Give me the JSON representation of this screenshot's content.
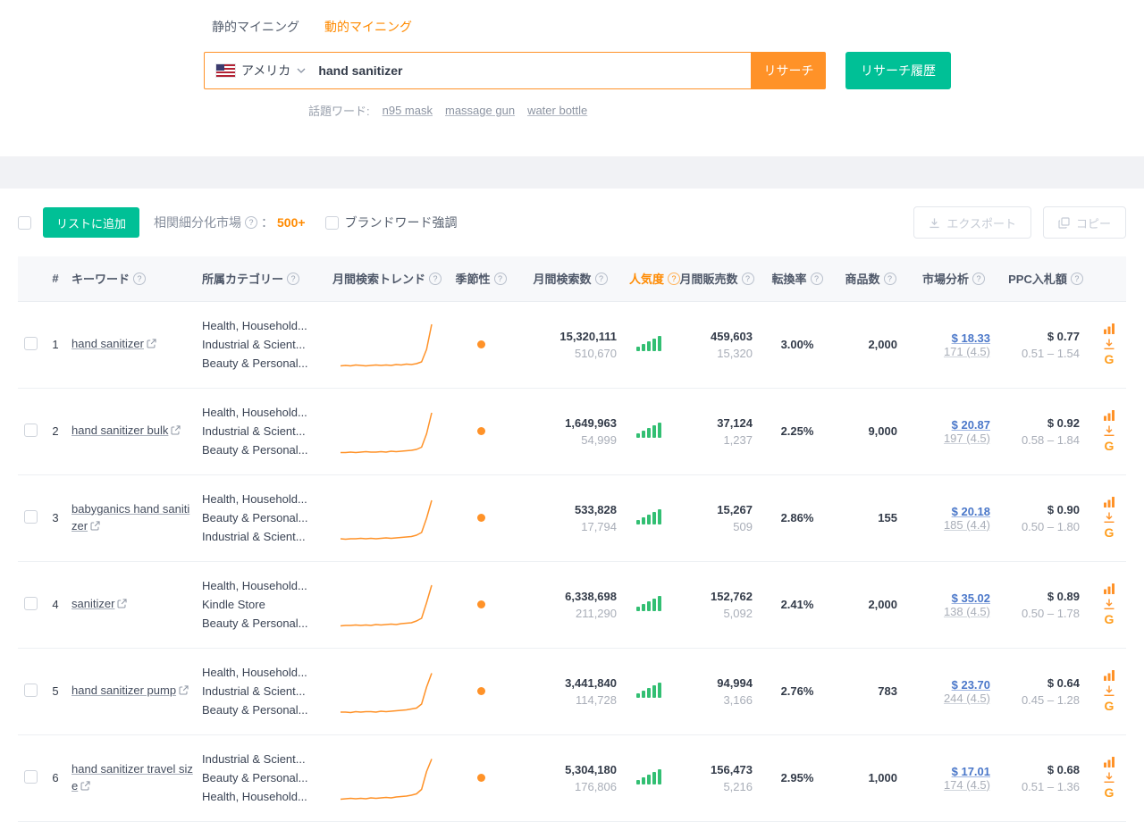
{
  "colors": {
    "accent_orange": "#ff9228",
    "accent_green": "#00c096",
    "popularity_green": "#33bf73",
    "link_blue": "#4a77c9"
  },
  "icons": {
    "help": "?",
    "google": "G"
  },
  "tabs": [
    {
      "label": "静的マイニング",
      "active": false
    },
    {
      "label": "動的マイニング",
      "active": true
    }
  ],
  "search": {
    "country": "アメリカ",
    "query": "hand sanitizer",
    "research_button": "リサーチ",
    "history_button": "リサーチ履歴",
    "hot_label": "話題ワード:",
    "hot_words": [
      "n95 mask",
      "massage gun",
      "water bottle"
    ]
  },
  "toolbar": {
    "add_to_list": "リストに追加",
    "niche_label": "相関細分化市場",
    "niche_colon": "：",
    "niche_value": "500+",
    "brand_toggle": "ブランドワード強調",
    "export": "エクスポート",
    "copy": "コピー"
  },
  "table": {
    "headers": {
      "index": "#",
      "keyword": "キーワード",
      "category": "所属カテゴリー",
      "trend": "月間検索トレンド",
      "season": "季節性",
      "search_volume": "月間検索数",
      "popularity": "人気度",
      "sales": "月間販売数",
      "conversion": "転換率",
      "products": "商品数",
      "market": "市場分析",
      "ppc": "PPC入札額"
    },
    "rows": [
      {
        "index": "1",
        "keyword": "hand sanitizer",
        "categories": [
          "Health, Household...",
          "Industrial & Scient...",
          "Beauty & Personal..."
        ],
        "trend": [
          3,
          4,
          3,
          5,
          4,
          3,
          4,
          5,
          4,
          5,
          4,
          6,
          5,
          7,
          6,
          8,
          12,
          40,
          96
        ],
        "search_volume": "15,320,111",
        "search_sub": "510,670",
        "sales": "459,603",
        "sales_sub": "15,320",
        "conversion": "3.00%",
        "products": "2,000",
        "price": "$ 18.33",
        "reviews": "171 (4.5)",
        "ppc": "$ 0.77",
        "ppc_range": "0.51 – 1.54"
      },
      {
        "index": "2",
        "keyword": "hand sanitizer bulk",
        "categories": [
          "Health, Household...",
          "Industrial & Scient...",
          "Beauty & Personal..."
        ],
        "trend": [
          3,
          3,
          4,
          3,
          4,
          5,
          4,
          4,
          5,
          4,
          6,
          5,
          6,
          7,
          8,
          10,
          15,
          45,
          92
        ],
        "search_volume": "1,649,963",
        "search_sub": "54,999",
        "sales": "37,124",
        "sales_sub": "1,237",
        "conversion": "2.25%",
        "products": "9,000",
        "price": "$ 20.87",
        "reviews": "197 (4.5)",
        "ppc": "$ 0.92",
        "ppc_range": "0.58 – 1.84"
      },
      {
        "index": "3",
        "keyword": "babyganics hand sanitizer",
        "categories": [
          "Health, Household...",
          "Beauty & Personal...",
          "Industrial & Scient..."
        ],
        "trend": [
          4,
          3,
          4,
          4,
          5,
          4,
          5,
          4,
          5,
          6,
          5,
          6,
          7,
          8,
          9,
          12,
          18,
          50,
          90
        ],
        "search_volume": "533,828",
        "search_sub": "17,794",
        "sales": "15,267",
        "sales_sub": "509",
        "conversion": "2.86%",
        "products": "155",
        "price": "$ 20.18",
        "reviews": "185 (4.4)",
        "ppc": "$ 0.90",
        "ppc_range": "0.50 – 1.80"
      },
      {
        "index": "4",
        "keyword": "sanitizer",
        "categories": [
          "Health, Household...",
          "Kindle Store",
          "Beauty & Personal..."
        ],
        "trend": [
          3,
          4,
          4,
          5,
          4,
          5,
          4,
          6,
          5,
          6,
          7,
          6,
          8,
          9,
          10,
          14,
          20,
          55,
          94
        ],
        "search_volume": "6,338,698",
        "search_sub": "211,290",
        "sales": "152,762",
        "sales_sub": "5,092",
        "conversion": "2.41%",
        "products": "2,000",
        "price": "$ 35.02",
        "reviews": "138 (4.5)",
        "ppc": "$ 0.89",
        "ppc_range": "0.50 – 1.78"
      },
      {
        "index": "5",
        "keyword": "hand sanitizer pump",
        "categories": [
          "Health, Household...",
          "Industrial & Scient...",
          "Beauty & Personal..."
        ],
        "trend": [
          4,
          4,
          3,
          5,
          4,
          5,
          5,
          4,
          6,
          5,
          6,
          7,
          8,
          9,
          11,
          13,
          22,
          60,
          91
        ],
        "search_volume": "3,441,840",
        "search_sub": "114,728",
        "sales": "94,994",
        "sales_sub": "3,166",
        "conversion": "2.76%",
        "products": "783",
        "price": "$ 23.70",
        "reviews": "244 (4.5)",
        "ppc": "$ 0.64",
        "ppc_range": "0.45 – 1.28"
      },
      {
        "index": "6",
        "keyword": "hand sanitizer travel size",
        "categories": [
          "Industrial & Scient...",
          "Beauty & Personal...",
          "Health, Household..."
        ],
        "trend": [
          3,
          4,
          5,
          4,
          5,
          4,
          6,
          5,
          6,
          7,
          6,
          8,
          9,
          10,
          12,
          15,
          25,
          65,
          93
        ],
        "search_volume": "5,304,180",
        "search_sub": "176,806",
        "sales": "156,473",
        "sales_sub": "5,216",
        "conversion": "2.95%",
        "products": "1,000",
        "price": "$ 17.01",
        "reviews": "174 (4.5)",
        "ppc": "$ 0.68",
        "ppc_range": "0.51 – 1.36"
      }
    ]
  }
}
